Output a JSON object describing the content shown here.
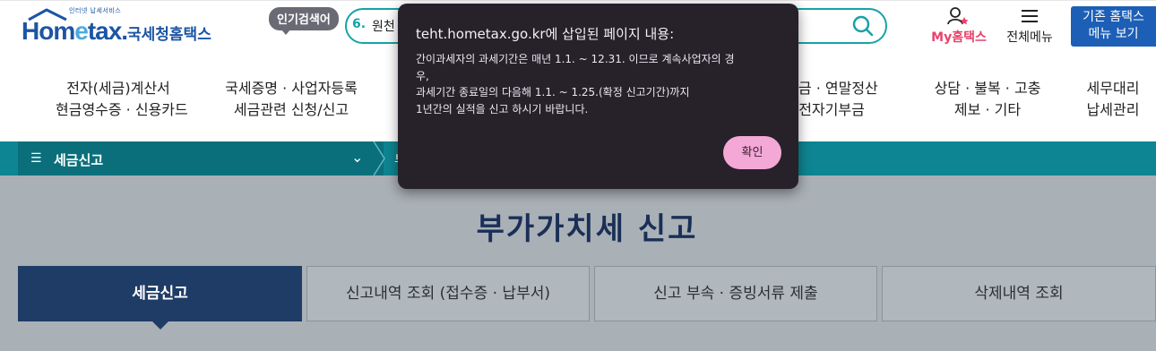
{
  "header": {
    "logo_tagline": "인터넷 납세서비스",
    "logo_main_a": "Hom",
    "logo_main_e": "e",
    "logo_main_b": "tax.",
    "logo_sub": "국세청홈택스",
    "popular_badge": "인기검색어",
    "search_rank": "6.",
    "search_term": "원천",
    "my_hometax": "My홈택스",
    "all_menu": "전체메뉴",
    "old_hometax_line1": "기존 홈택스",
    "old_hometax_line2": "메뉴 보기"
  },
  "nav": [
    {
      "line1": "전자(세금)계산서",
      "line2": "현금영수증 · 신용카드"
    },
    {
      "line1": "국세증명 · 사업자등록",
      "line2": "세금관련 신청/신고"
    },
    {
      "line1": "현금 · 연말정산",
      "line2": "전자기부금"
    },
    {
      "line1": "상담 · 불복 · 고충",
      "line2": "제보 · 기타"
    },
    {
      "line1": "세무대리",
      "line2": "납세관리"
    }
  ],
  "breadcrumb": {
    "current": "세금신고",
    "next": "부"
  },
  "page": {
    "title": "부가가치세 신고",
    "tabs": [
      {
        "label": "세금신고",
        "active": true
      },
      {
        "label": "신고내역 조회 (접수증 · 납부서)",
        "active": false
      },
      {
        "label": "신고 부속 · 증빙서류 제출",
        "active": false
      },
      {
        "label": "삭제내역 조회",
        "active": false
      }
    ]
  },
  "dialog": {
    "title": "teht.hometax.go.kr에 삽입된 페이지 내용:",
    "message_lines": [
      "간이과세자의 과세기간은 매년 1.1. ~ 12.31. 이므로 계속사업자의 경",
      "우,",
      "과세기간 종료일의 다음해 1.1. ~ 1.25.(확정 신고기간)까지",
      "1년간의 실적을 신고 하시기 바랍니다."
    ],
    "ok_label": "확인"
  },
  "colors": {
    "brand_blue": "#1c55a4",
    "teal": "#0e8592",
    "active_tab": "#1e3c65",
    "my_hometax": "#e8426b",
    "ok_button": "#f3a8d6"
  }
}
